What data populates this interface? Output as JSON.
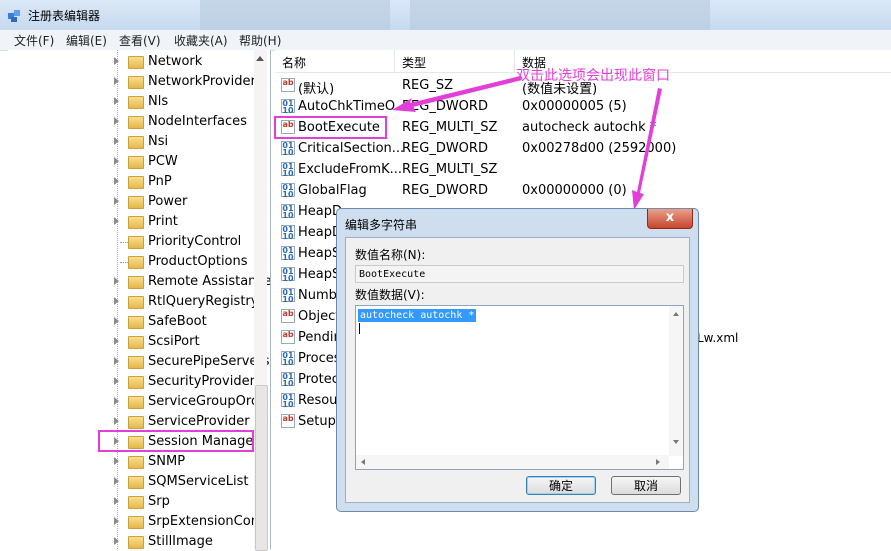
{
  "window": {
    "title": "注册表编辑器"
  },
  "menu": [
    "文件(F)",
    "编辑(E)",
    "查看(V)",
    "收藏夹(A)",
    "帮助(H)"
  ],
  "tree": {
    "items": [
      "Network",
      "NetworkProvider",
      "Nls",
      "NodeInterfaces",
      "Nsi",
      "PCW",
      "PnP",
      "Power",
      "Print",
      "PriorityControl",
      "ProductOptions",
      "Remote Assistance",
      "RtlQueryRegistryC",
      "SafeBoot",
      "ScsiPort",
      "SecurePipeServers",
      "SecurityProviders",
      "ServiceGroupOrde",
      "ServiceProvider",
      "Session Manager",
      "SNMP",
      "SQMServiceList",
      "Srp",
      "SrpExtensionConf",
      "StillImage"
    ],
    "selected": "Session Manager"
  },
  "values_list": {
    "headers": {
      "name": "名称",
      "type": "类型",
      "data": "数据"
    },
    "rows": [
      {
        "icon": "ab",
        "name": "(默认)",
        "type": "REG_SZ",
        "data": "(数值未设置)"
      },
      {
        "icon": "bin",
        "name": "AutoChkTimeO...",
        "type": "REG_DWORD",
        "data": "0x00000005 (5)"
      },
      {
        "icon": "ab",
        "name": "BootExecute",
        "type": "REG_MULTI_SZ",
        "data": "autocheck autochk *"
      },
      {
        "icon": "bin",
        "name": "CriticalSection...",
        "type": "REG_DWORD",
        "data": "0x00278d00 (2592000)"
      },
      {
        "icon": "bin",
        "name": "ExcludeFromK...",
        "type": "REG_MULTI_SZ",
        "data": ""
      },
      {
        "icon": "bin",
        "name": "GlobalFlag",
        "type": "REG_DWORD",
        "data": "0x00000000 (0)"
      },
      {
        "icon": "bin",
        "name": "HeapD",
        "type": "",
        "data": ""
      },
      {
        "icon": "bin",
        "name": "HeapD",
        "type": "",
        "data": ""
      },
      {
        "icon": "bin",
        "name": "HeapS",
        "type": "",
        "data": ""
      },
      {
        "icon": "bin",
        "name": "HeapS",
        "type": "",
        "data": ""
      },
      {
        "icon": "bin",
        "name": "Numbe",
        "type": "",
        "data": ""
      },
      {
        "icon": "ab",
        "name": "Object",
        "type": "",
        "data": ""
      },
      {
        "icon": "ab",
        "name": "Pendin",
        "type": "",
        "data": ""
      },
      {
        "icon": "bin",
        "name": "Proces",
        "type": "",
        "data": ""
      },
      {
        "icon": "bin",
        "name": "Protec",
        "type": "",
        "data": ""
      },
      {
        "icon": "bin",
        "name": "Resour",
        "type": "",
        "data": ""
      },
      {
        "icon": "ab",
        "name": "SetupE",
        "type": "",
        "data": ""
      }
    ],
    "partial_data_text": "Lw.xml"
  },
  "annotation": {
    "text": "双击此选项会出现此窗口",
    "color": "#e23fd8"
  },
  "dialog": {
    "title": "编辑多字符串",
    "name_label": "数值名称(N):",
    "name_value": "BootExecute",
    "data_label": "数值数据(V):",
    "data_value": "autocheck autochk *",
    "ok_label": "确定",
    "cancel_label": "取消",
    "close_glyph": "x"
  }
}
